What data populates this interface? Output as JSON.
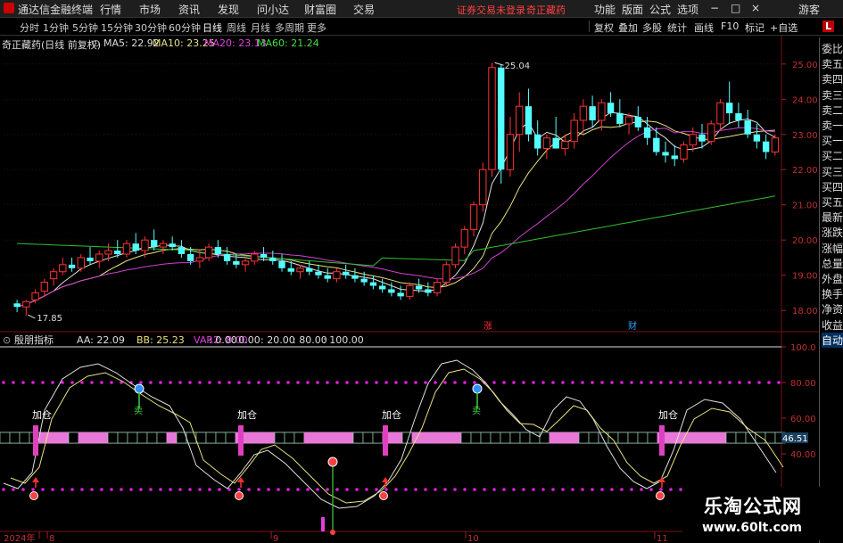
{
  "menubar": {
    "app_title": "通达信金融终端",
    "items": [
      "行情",
      "市场",
      "资讯",
      "发现",
      "问小达",
      "财富圈",
      "交易"
    ],
    "warning": "证券交易未登录",
    "stock": "奇正藏药",
    "right_items": [
      "功能",
      "版面",
      "公式",
      "选项"
    ],
    "guest": "游客"
  },
  "toolbar": {
    "periods": [
      "分时",
      "1分钟",
      "5分钟",
      "15分钟",
      "30分钟",
      "60分钟",
      "日线",
      "周线",
      "月线",
      "多周期",
      "更多"
    ],
    "active": "日线",
    "right_buttons": [
      "复权",
      "叠加",
      "多股",
      "统计",
      "画线",
      "F10",
      "标记",
      "+自选"
    ],
    "l_button": "L"
  },
  "main_info": {
    "name": "奇正藏药(日线 前复权)",
    "ma5": "MA5: 22.92",
    "ma10": "MA10: 23.25",
    "ma20": "MA20: 23.13",
    "ma60": "MA60: 21.24"
  },
  "price_axis": [
    "25.00",
    "24.00",
    "23.00",
    "22.00",
    "21.00",
    "20.00",
    "19.00",
    "18.00"
  ],
  "high_label": "25.04",
  "low_label": "17.85",
  "markers": {
    "zhang": "涨",
    "cai": "财"
  },
  "indicator_info": {
    "name": "殷朋指标",
    "aa": "AA: 22.09",
    "bb": "BB: 25.23",
    "var2_label": "VAR2: 8.00",
    "vals": [
      ": 0.00",
      ": 0.00",
      ": 20.00",
      ": 80.00",
      ": 100.00"
    ]
  },
  "indicator_axis": [
    "100.0",
    "80.00",
    "60.00",
    "40.00"
  ],
  "indicator_current": "46.51",
  "signals": {
    "add": "加仓",
    "sell": "卖"
  },
  "date_axis": [
    "2024年",
    "8",
    "9",
    "10",
    "11"
  ],
  "right_panel": [
    "委比",
    "卖五",
    "卖四",
    "卖三",
    "卖二",
    "卖一",
    "买一",
    "买二",
    "买三",
    "买四",
    "买五",
    "最新",
    "涨跌",
    "涨幅",
    "总量",
    "外盘",
    "换手",
    "净资",
    "收益",
    "自动"
  ],
  "watermark": {
    "name": "乐淘公式网",
    "url": "www.60lt.com"
  },
  "chart_data": {
    "type": "candlestick",
    "y_range": [
      17.7,
      25.4
    ],
    "indicator_range": [
      0,
      100
    ],
    "ohlc": [
      [
        18.2,
        18.3,
        17.95,
        18.1
      ],
      [
        18.1,
        18.3,
        17.85,
        18.25
      ],
      [
        18.3,
        18.6,
        18.2,
        18.5
      ],
      [
        18.55,
        18.9,
        18.4,
        18.8
      ],
      [
        18.9,
        19.2,
        18.7,
        19.1
      ],
      [
        19.1,
        19.5,
        19.0,
        19.3
      ],
      [
        19.3,
        19.5,
        19.1,
        19.2
      ],
      [
        19.2,
        19.6,
        19.1,
        19.5
      ],
      [
        19.5,
        19.8,
        19.3,
        19.4
      ],
      [
        19.4,
        19.7,
        19.2,
        19.6
      ],
      [
        19.6,
        19.9,
        19.4,
        19.7
      ],
      [
        19.7,
        20.0,
        19.5,
        19.6
      ],
      [
        19.6,
        20.0,
        19.5,
        19.9
      ],
      [
        19.9,
        20.2,
        19.6,
        19.7
      ],
      [
        19.7,
        20.1,
        19.5,
        20.0
      ],
      [
        20.0,
        20.3,
        19.7,
        19.8
      ],
      [
        19.8,
        20.0,
        19.6,
        19.9
      ],
      [
        19.9,
        20.1,
        19.7,
        19.8
      ],
      [
        19.8,
        20.0,
        19.5,
        19.6
      ],
      [
        19.6,
        19.8,
        19.3,
        19.4
      ],
      [
        19.4,
        19.7,
        19.2,
        19.5
      ],
      [
        19.5,
        19.9,
        19.4,
        19.8
      ],
      [
        19.8,
        20.0,
        19.5,
        19.6
      ],
      [
        19.6,
        19.8,
        19.3,
        19.4
      ],
      [
        19.4,
        19.6,
        19.2,
        19.3
      ],
      [
        19.3,
        19.5,
        19.1,
        19.4
      ],
      [
        19.4,
        19.7,
        19.3,
        19.6
      ],
      [
        19.6,
        19.8,
        19.4,
        19.5
      ],
      [
        19.5,
        19.7,
        19.3,
        19.4
      ],
      [
        19.4,
        19.6,
        19.1,
        19.2
      ],
      [
        19.2,
        19.4,
        19.0,
        19.1
      ],
      [
        19.1,
        19.3,
        18.9,
        19.2
      ],
      [
        19.2,
        19.4,
        19.0,
        19.1
      ],
      [
        19.1,
        19.3,
        18.9,
        19.0
      ],
      [
        19.0,
        19.2,
        18.8,
        18.9
      ],
      [
        18.9,
        19.2,
        18.8,
        19.1
      ],
      [
        19.1,
        19.3,
        18.9,
        19.0
      ],
      [
        19.0,
        19.2,
        18.8,
        18.9
      ],
      [
        18.9,
        19.1,
        18.7,
        18.8
      ],
      [
        18.8,
        19.0,
        18.6,
        18.7
      ],
      [
        18.7,
        18.9,
        18.5,
        18.6
      ],
      [
        18.6,
        18.8,
        18.4,
        18.5
      ],
      [
        18.5,
        18.7,
        18.3,
        18.4
      ],
      [
        18.4,
        18.8,
        18.3,
        18.7
      ],
      [
        18.7,
        18.9,
        18.5,
        18.6
      ],
      [
        18.6,
        18.8,
        18.4,
        18.5
      ],
      [
        18.5,
        18.9,
        18.4,
        18.8
      ],
      [
        18.8,
        19.4,
        18.7,
        19.3
      ],
      [
        19.3,
        19.9,
        19.2,
        19.8
      ],
      [
        19.8,
        20.4,
        19.6,
        20.3
      ],
      [
        20.3,
        21.1,
        20.1,
        21.0
      ],
      [
        21.0,
        22.2,
        20.8,
        22.0
      ],
      [
        22.0,
        25.04,
        21.8,
        24.9
      ],
      [
        24.9,
        25.0,
        21.6,
        22.0
      ],
      [
        22.0,
        23.5,
        21.8,
        23.0
      ],
      [
        23.0,
        24.2,
        22.5,
        23.8
      ],
      [
        23.8,
        24.3,
        22.8,
        23.0
      ],
      [
        23.0,
        23.4,
        22.4,
        22.6
      ],
      [
        22.6,
        23.0,
        22.3,
        22.9
      ],
      [
        22.9,
        23.5,
        22.6,
        22.6
      ],
      [
        22.6,
        23.0,
        22.4,
        22.8
      ],
      [
        22.8,
        23.6,
        22.6,
        23.4
      ],
      [
        23.4,
        24.0,
        23.0,
        23.8
      ],
      [
        23.8,
        24.1,
        23.2,
        23.4
      ],
      [
        23.4,
        24.0,
        23.1,
        23.9
      ],
      [
        23.9,
        24.2,
        23.5,
        23.6
      ],
      [
        23.6,
        24.0,
        23.2,
        23.3
      ],
      [
        23.3,
        23.6,
        23.0,
        23.5
      ],
      [
        23.5,
        23.8,
        23.1,
        23.2
      ],
      [
        23.2,
        23.5,
        22.7,
        22.9
      ],
      [
        22.9,
        23.2,
        22.4,
        22.5
      ],
      [
        22.5,
        22.8,
        22.2,
        22.4
      ],
      [
        22.4,
        22.7,
        22.1,
        22.3
      ],
      [
        22.3,
        22.8,
        22.2,
        22.7
      ],
      [
        22.7,
        23.2,
        22.5,
        23.0
      ],
      [
        23.0,
        23.3,
        22.6,
        22.8
      ],
      [
        22.8,
        23.4,
        22.7,
        23.3
      ],
      [
        23.3,
        24.0,
        23.1,
        23.9
      ],
      [
        23.9,
        24.5,
        23.3,
        23.6
      ],
      [
        23.6,
        23.9,
        23.2,
        23.4
      ],
      [
        23.4,
        23.7,
        22.9,
        23.0
      ],
      [
        23.0,
        23.3,
        22.6,
        22.8
      ],
      [
        22.8,
        23.0,
        22.3,
        22.5
      ],
      [
        22.5,
        23.0,
        22.4,
        22.9
      ]
    ]
  }
}
